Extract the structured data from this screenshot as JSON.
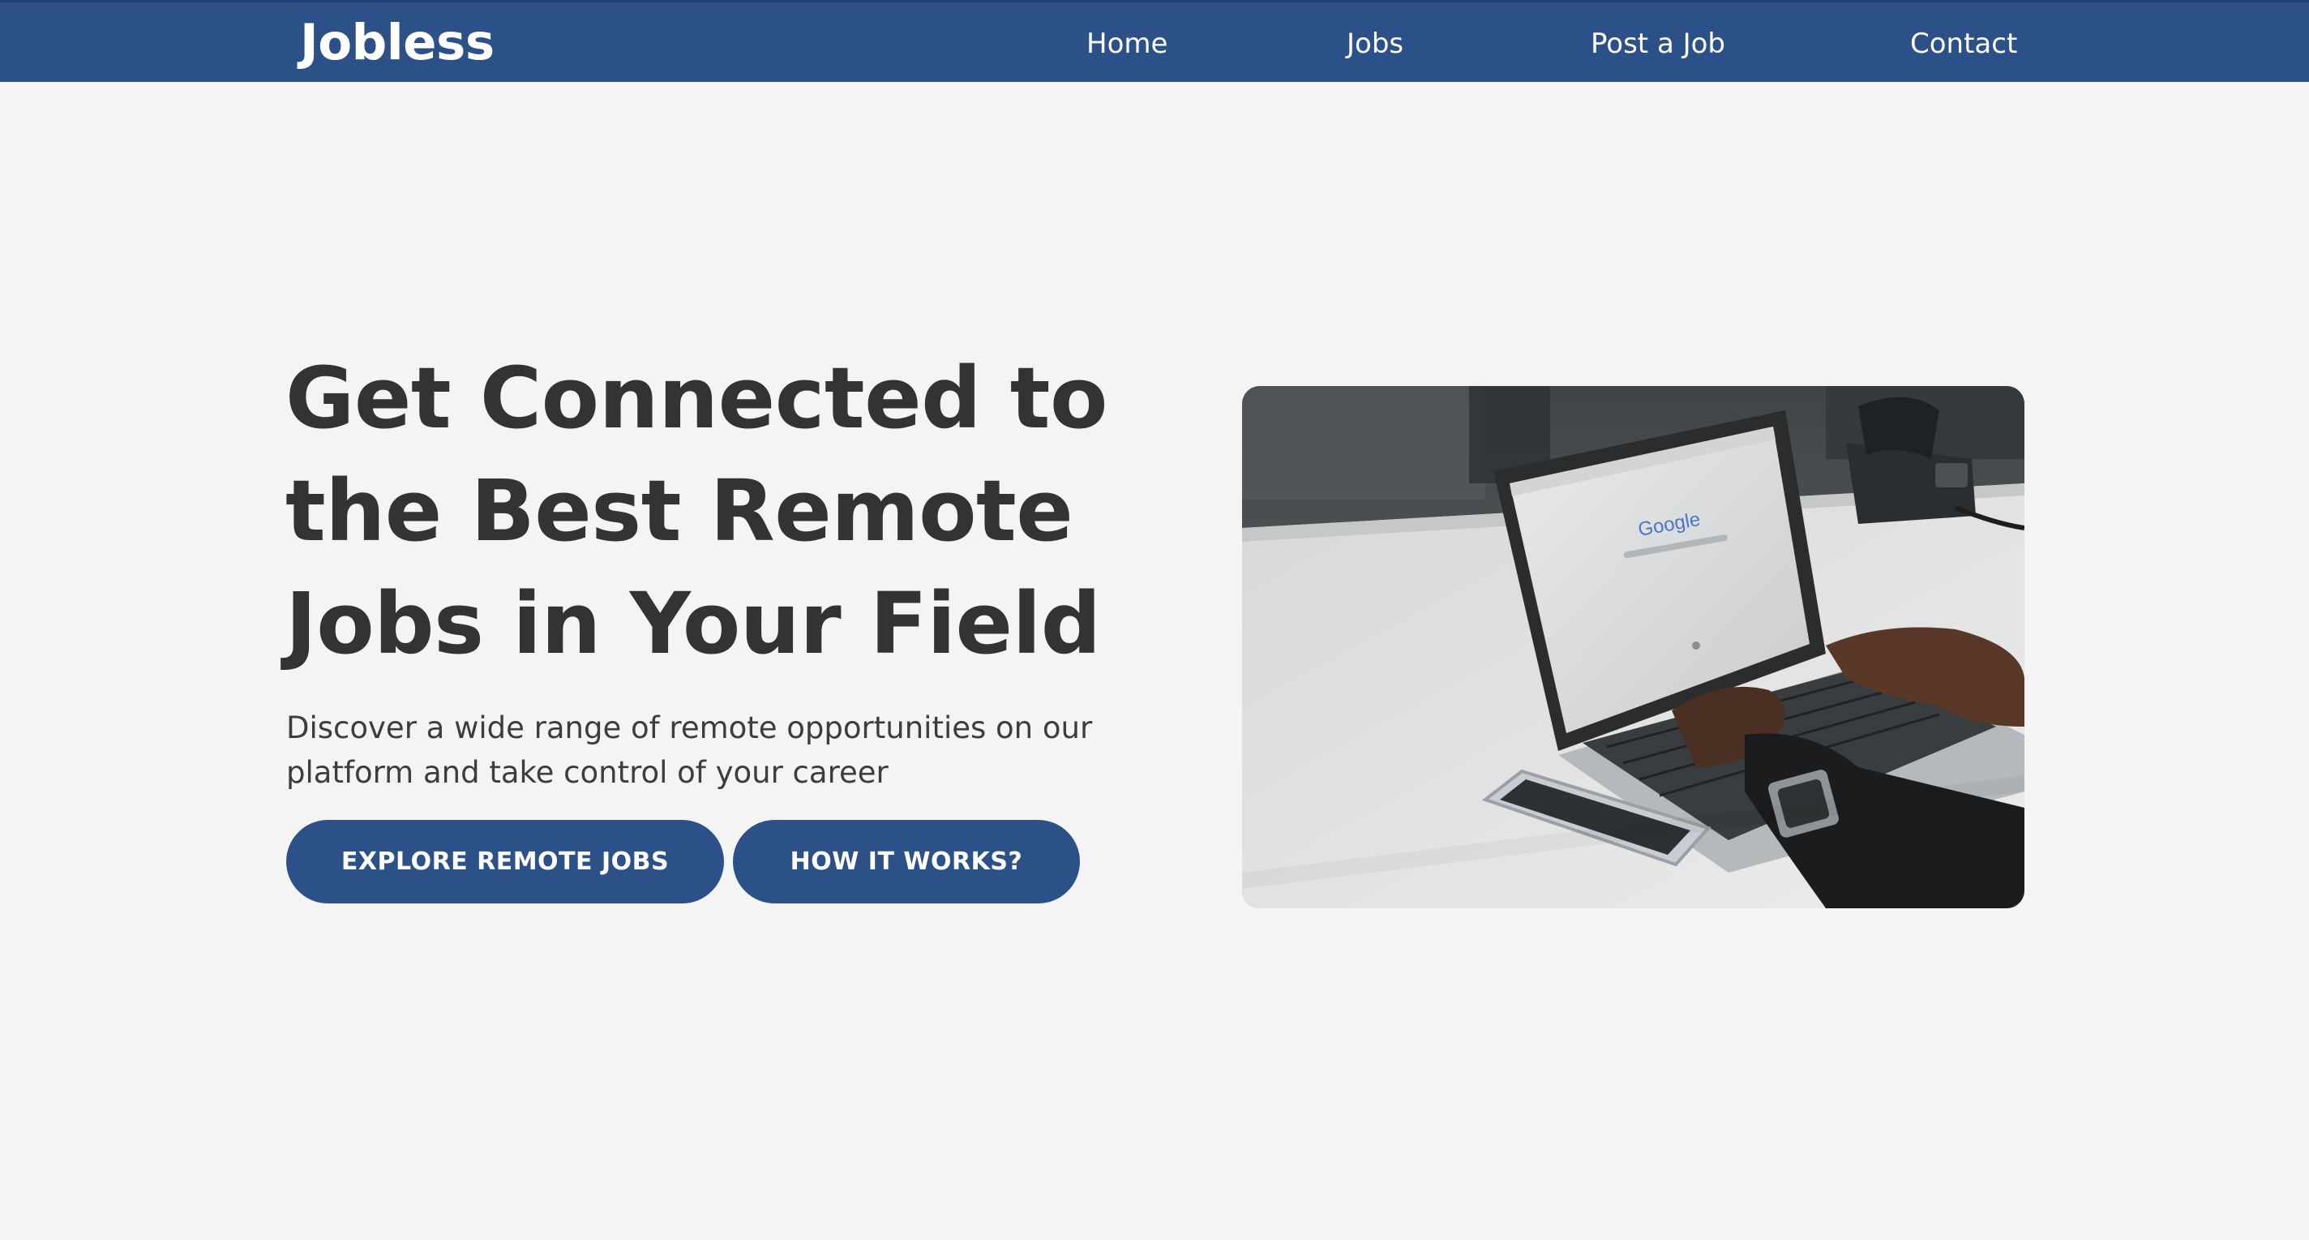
{
  "navbar": {
    "brand": "Jobless",
    "links": [
      {
        "label": "Home"
      },
      {
        "label": "Jobs"
      },
      {
        "label": "Post a Job"
      },
      {
        "label": "Contact"
      }
    ],
    "background_color": "#2c5088"
  },
  "hero": {
    "title": "Get Connected to the Best Remote Jobs in Your Field",
    "subtitle": "Discover a wide range of remote opportunities on our platform and take control of your career",
    "buttons": {
      "explore_label": "EXPLORE REMOTE JOBS",
      "how_label": "HOW IT WORKS?"
    },
    "image": {
      "screen_logo_text": "Google"
    }
  },
  "colors": {
    "accent": "#2c5088",
    "page_background": "#f4f4f4",
    "heading_text": "#333333"
  }
}
